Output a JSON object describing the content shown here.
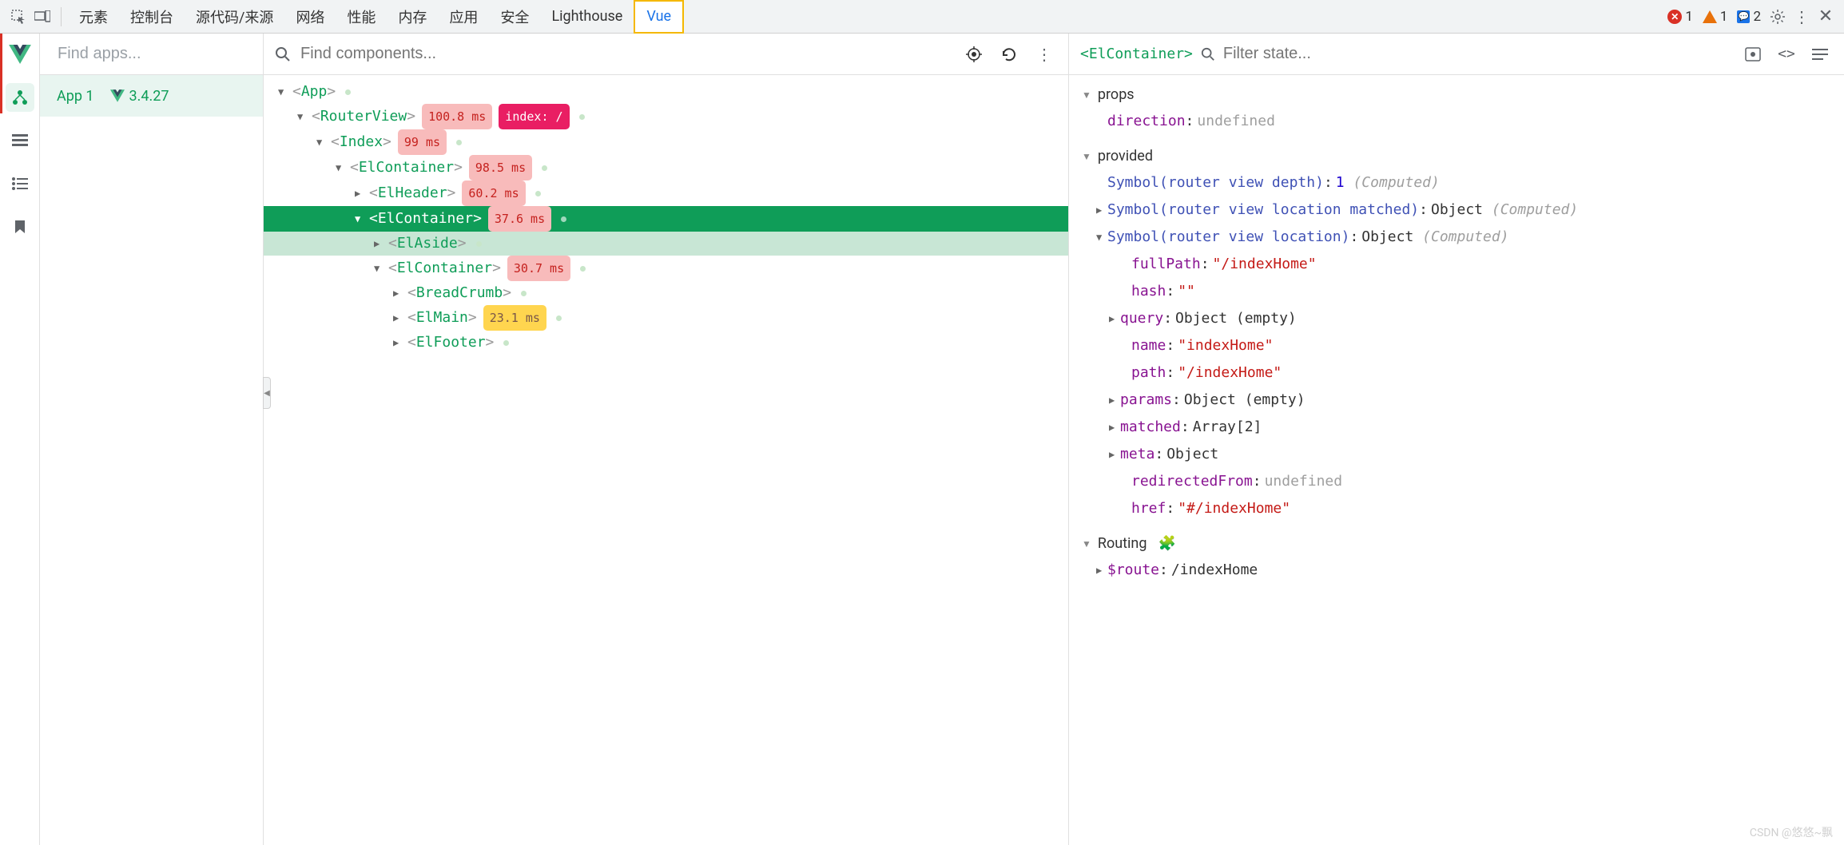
{
  "devtools": {
    "tabs": [
      "元素",
      "控制台",
      "源代码/来源",
      "网络",
      "性能",
      "内存",
      "应用",
      "安全",
      "Lighthouse",
      "Vue"
    ],
    "active_tab": "Vue",
    "errors": "1",
    "warnings": "1",
    "info": "2"
  },
  "apps": {
    "search_placeholder": "Find apps...",
    "app_name": "App 1",
    "vue_version": "3.4.27"
  },
  "components": {
    "search_placeholder": "Find components...",
    "tree": {
      "app": "App",
      "routerview": "RouterView",
      "routerview_ms": "100.8 ms",
      "routerview_path": "index: /",
      "index": "Index",
      "index_ms": "99 ms",
      "elcontainer1": "ElContainer",
      "elcontainer1_ms": "98.5 ms",
      "elheader": "ElHeader",
      "elheader_ms": "60.2 ms",
      "elcontainer2": "ElContainer",
      "elcontainer2_ms": "37.6 ms",
      "elaside": "ElAside",
      "elcontainer3": "ElContainer",
      "elcontainer3_ms": "30.7 ms",
      "breadcrumb": "BreadCrumb",
      "elmain": "ElMain",
      "elmain_ms": "23.1 ms",
      "elfooter": "ElFooter"
    }
  },
  "state": {
    "selected": "<ElContainer>",
    "filter_placeholder": "Filter state...",
    "sections": {
      "props": "props",
      "provided": "provided",
      "routing": "Routing"
    },
    "props": {
      "direction_key": "direction",
      "direction_val": "undefined"
    },
    "provided": {
      "sym_depth": "Symbol(router view depth)",
      "sym_depth_val": "1",
      "computed": "(Computed)",
      "sym_loc_matched": "Symbol(router view location matched)",
      "sym_loc_matched_val": "Object",
      "sym_loc": "Symbol(router view location)",
      "sym_loc_val": "Object",
      "fullPath_k": "fullPath",
      "fullPath_v": "\"/indexHome\"",
      "hash_k": "hash",
      "hash_v": "\"\"",
      "query_k": "query",
      "query_v": "Object (empty)",
      "name_k": "name",
      "name_v": "\"indexHome\"",
      "path_k": "path",
      "path_v": "\"/indexHome\"",
      "params_k": "params",
      "params_v": "Object (empty)",
      "matched_k": "matched",
      "matched_v": "Array[2]",
      "meta_k": "meta",
      "meta_v": "Object",
      "redirected_k": "redirectedFrom",
      "redirected_v": "undefined",
      "href_k": "href",
      "href_v": "\"#/indexHome\""
    },
    "routing": {
      "route_k": "$route",
      "route_v": "/indexHome"
    }
  },
  "watermark": "CSDN @悠悠~飘"
}
